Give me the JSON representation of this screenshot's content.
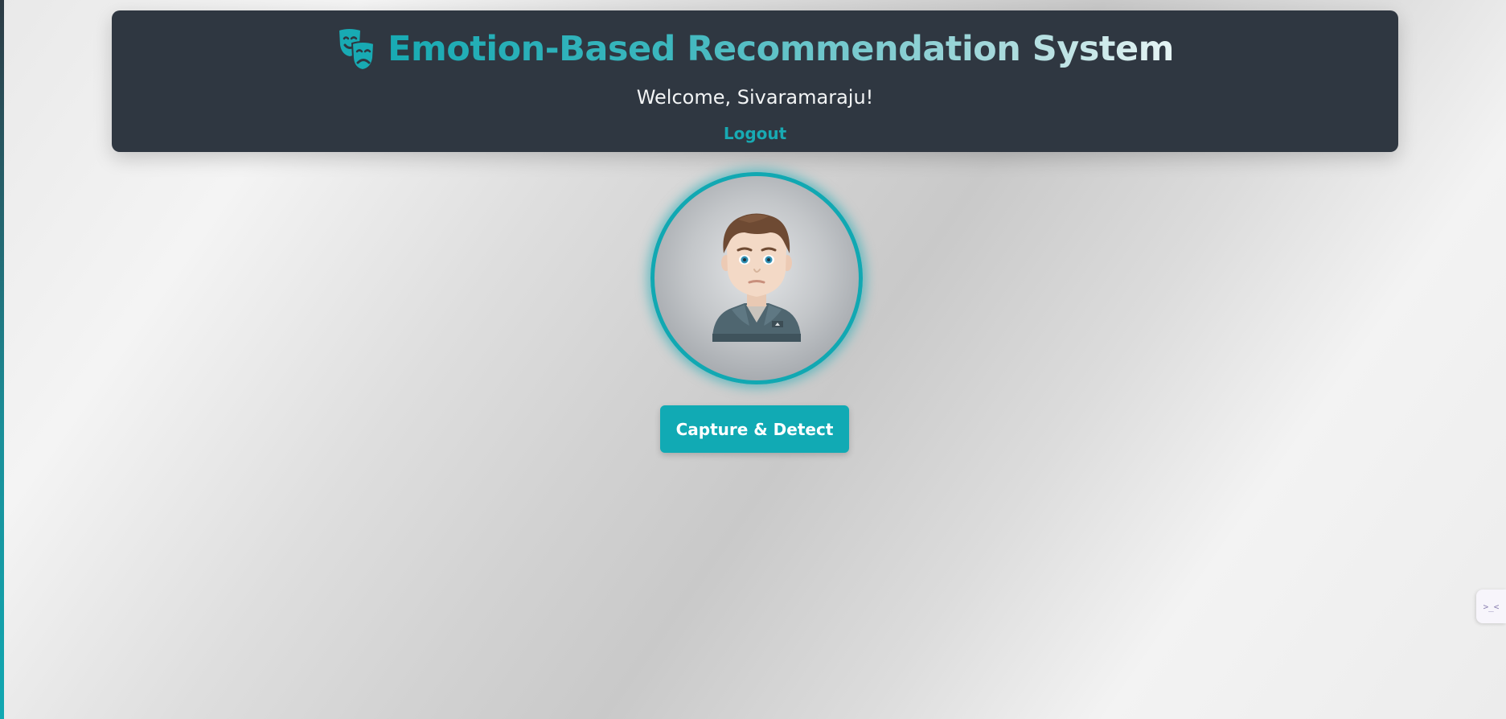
{
  "header": {
    "icon": "theater-masks-icon",
    "title": "Emotion-Based Recommendation System",
    "welcome": "Welcome, Sivaramaraju!",
    "logout_label": "Logout"
  },
  "avatar": {
    "icon": "user-avatar-icon"
  },
  "actions": {
    "capture_label": "Capture & Detect"
  },
  "side_widget": {
    "icon": "chat-widget-icon",
    "glyph": ">_<"
  },
  "colors": {
    "accent": "#11aab4",
    "header_bg": "#2f3741",
    "welcome_text": "#f2f4f5"
  }
}
